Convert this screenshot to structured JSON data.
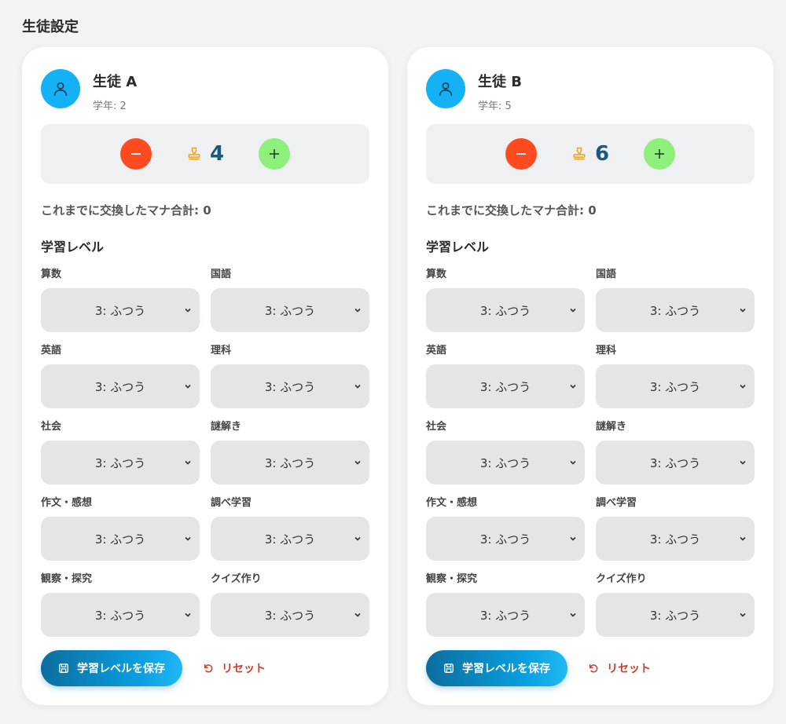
{
  "page": {
    "title": "生徒設定"
  },
  "students": [
    {
      "name": "生徒 A",
      "grade": "学年: 2",
      "mana": "4",
      "exchange_total": "これまでに交換したマナ合計: 0",
      "section_title": "学習レベル",
      "subjects": [
        {
          "label": "算数",
          "value": "3: ふつう"
        },
        {
          "label": "国語",
          "value": "3: ふつう"
        },
        {
          "label": "英語",
          "value": "3: ふつう"
        },
        {
          "label": "理科",
          "value": "3: ふつう"
        },
        {
          "label": "社会",
          "value": "3: ふつう"
        },
        {
          "label": "謎解き",
          "value": "3: ふつう"
        },
        {
          "label": "作文・感想",
          "value": "3: ふつう"
        },
        {
          "label": "調べ学習",
          "value": "3: ふつう"
        },
        {
          "label": "観察・探究",
          "value": "3: ふつう"
        },
        {
          "label": "クイズ作り",
          "value": "3: ふつう"
        }
      ],
      "save_label": "学習レベルを保存",
      "reset_label": "リセット"
    },
    {
      "name": "生徒 B",
      "grade": "学年: 5",
      "mana": "6",
      "exchange_total": "これまでに交換したマナ合計: 0",
      "section_title": "学習レベル",
      "subjects": [
        {
          "label": "算数",
          "value": "3: ふつう"
        },
        {
          "label": "国語",
          "value": "3: ふつう"
        },
        {
          "label": "英語",
          "value": "3: ふつう"
        },
        {
          "label": "理科",
          "value": "3: ふつう"
        },
        {
          "label": "社会",
          "value": "3: ふつう"
        },
        {
          "label": "謎解き",
          "value": "3: ふつう"
        },
        {
          "label": "作文・感想",
          "value": "3: ふつう"
        },
        {
          "label": "調べ学習",
          "value": "3: ふつう"
        },
        {
          "label": "観察・探究",
          "value": "3: ふつう"
        },
        {
          "label": "クイズ作り",
          "value": "3: ふつう"
        }
      ],
      "save_label": "学習レベルを保存",
      "reset_label": "リセット"
    }
  ],
  "icons": {
    "avatar": "user-icon",
    "minus": "minus-icon",
    "plus": "plus-icon",
    "mana": "stamp-icon",
    "select": "chevron-down-icon",
    "save": "save-icon",
    "reset": "reset-icon"
  },
  "colors": {
    "avatar": "#14b2f4",
    "minus": "#ff4b1f",
    "plus": "#8ef07a",
    "mana_number": "#1a5a7e",
    "save_button": "#0a9fe0",
    "reset": "#d23a2a"
  }
}
